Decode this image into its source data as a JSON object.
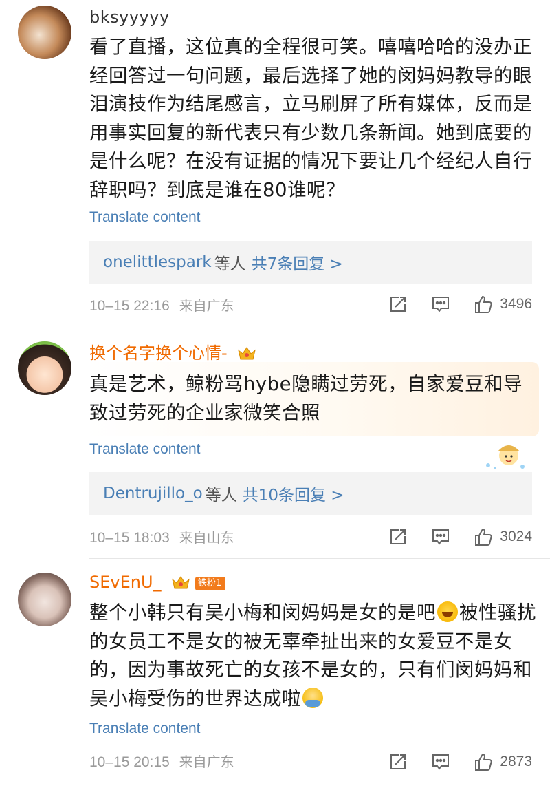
{
  "comments": [
    {
      "username": "bksyyyyy",
      "text": "看了直播，这位真的全程很可笑。嘻嘻哈哈的没办正经回答过一句问题，最后选择了她的闵妈妈教导的眼泪演技作为结尾感言，立马刷屏了所有媒体，反而是用事实回复的新代表只有少数几条新闻。她到底要的是什么呢？在没有证据的情况下要让几个经纪人自行辞职吗？到底是谁在80谁呢？",
      "translate": "Translate content",
      "replies": {
        "user": "onelittlespark",
        "etc": "等人",
        "count": "共7条回复 >"
      },
      "time": "10–15 22:16",
      "location": "来自广东",
      "likes": "3496"
    },
    {
      "username": "换个名字换个心情-",
      "text": "真是艺术，鲸粉骂hybe隐瞒过劳死，自家爱豆和导致过劳死的企业家微笑合照",
      "translate": "Translate content",
      "replies": {
        "user": "Dentrujillo_o",
        "etc": "等人",
        "count": "共10条回复 >"
      },
      "time": "10–15 18:03",
      "location": "来自山东",
      "likes": "3024"
    },
    {
      "username": "SEvEnU_",
      "badge": "铁粉1",
      "text_a": "整个小韩只有吴小梅和闵妈妈是女的是吧",
      "text_b": "被性骚扰的女员工不是女的被无辜牵扯出来的女爱豆不是女的，因为事故死亡的女孩不是女的，只有们闵妈妈和吴小梅受伤的世界达成啦",
      "translate": "Translate content",
      "time": "10–15 20:15",
      "location": "来自广东",
      "likes": "2873"
    }
  ],
  "icons": {
    "repost": "repost-icon",
    "comment": "comment-icon",
    "like": "thumbs-up-icon"
  }
}
